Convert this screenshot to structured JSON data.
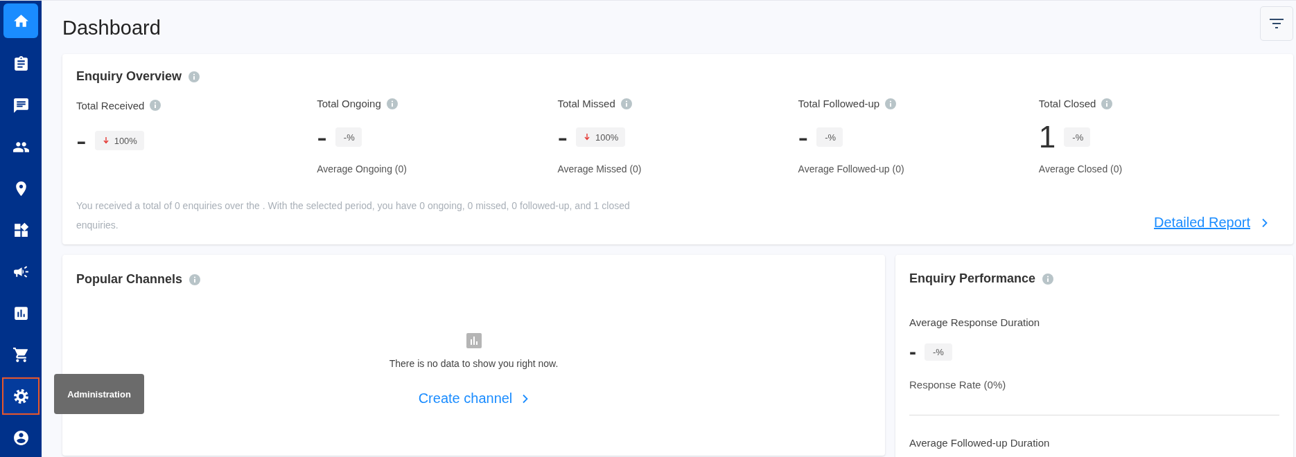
{
  "sidebar": {
    "items": [
      {
        "selected": true,
        "highlighted": false
      },
      {
        "selected": false,
        "highlighted": false
      },
      {
        "selected": false,
        "highlighted": false
      },
      {
        "selected": false,
        "highlighted": false
      },
      {
        "selected": false,
        "highlighted": false
      },
      {
        "selected": false,
        "highlighted": false
      },
      {
        "selected": false,
        "highlighted": false
      },
      {
        "selected": false,
        "highlighted": false
      },
      {
        "selected": false,
        "highlighted": false
      },
      {
        "selected": false,
        "highlighted": true
      },
      {
        "selected": false,
        "highlighted": false
      }
    ],
    "tooltip": "Administration"
  },
  "page": {
    "title": "Dashboard"
  },
  "overview": {
    "title": "Enquiry Overview",
    "metrics": [
      {
        "label": "Total Received",
        "value": "-",
        "change": "100%",
        "decrease": true
      },
      {
        "label": "Total Ongoing",
        "value": "-",
        "change": "-%",
        "decrease": false,
        "average": "Average Ongoing (0)"
      },
      {
        "label": "Total Missed",
        "value": "-",
        "change": "100%",
        "decrease": true,
        "average": "Average Missed (0)"
      },
      {
        "label": "Total Followed-up",
        "value": "-",
        "change": "-%",
        "decrease": false,
        "average": "Average Followed-up (0)"
      },
      {
        "label": "Total Closed",
        "value": "1",
        "change": "-%",
        "decrease": false,
        "average": "Average Closed (0)"
      }
    ],
    "summary": "You received a total of 0 enquiries over the . With the selected period, you have 0 ongoing, 0 missed, 0 followed-up, and 1 closed enquiries.",
    "link": "Detailed Report"
  },
  "channels": {
    "title": "Popular Channels",
    "empty_message": "There is no data to show you right now.",
    "action": "Create channel"
  },
  "performance": {
    "title": "Enquiry Performance",
    "sections": [
      {
        "label": "Average Response Duration",
        "value": "-",
        "change": "-%",
        "note": "Response Rate (0%)"
      },
      {
        "label": "Average Followed-up Duration"
      }
    ]
  }
}
